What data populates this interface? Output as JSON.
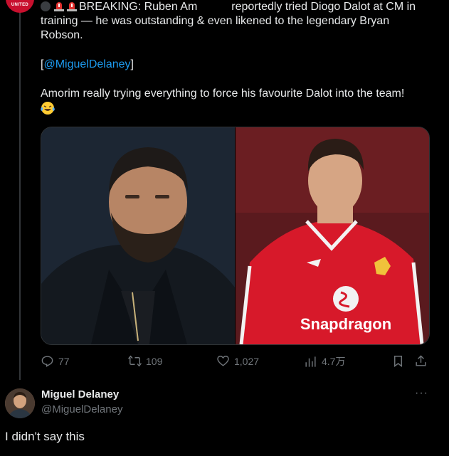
{
  "top_avatar": {
    "label": "UNITED",
    "color": "#c8102e"
  },
  "tweet": {
    "line1_pre": "BREAKING: Ruben Am",
    "line1_post": "reportedly tried Diogo Dalot at CM in",
    "line2": "training — he was outstanding & even likened to the legendary Bryan",
    "line3": "Robson.",
    "mention_open": "[",
    "mention": "@MiguelDelaney",
    "mention_close": "]",
    "line4": "Amorim really trying everything to force his favourite Dalot into the team!",
    "emoji_icon": "laughing-tears-emoji-icon"
  },
  "media": {
    "right_photo": {
      "sponsor": "Snapdragon",
      "shirt_color": "#d7192a"
    }
  },
  "actions": {
    "replies": "77",
    "reposts": "109",
    "likes": "1,027",
    "views": "4.7万"
  },
  "reply": {
    "name": "Miguel Delaney",
    "handle": "@MiguelDelaney",
    "more": "···",
    "text": "I didn't say this"
  },
  "colors": {
    "accent": "#1d9bf0",
    "muted": "#71767b",
    "text": "#e7e9ea",
    "background": "#000000"
  }
}
